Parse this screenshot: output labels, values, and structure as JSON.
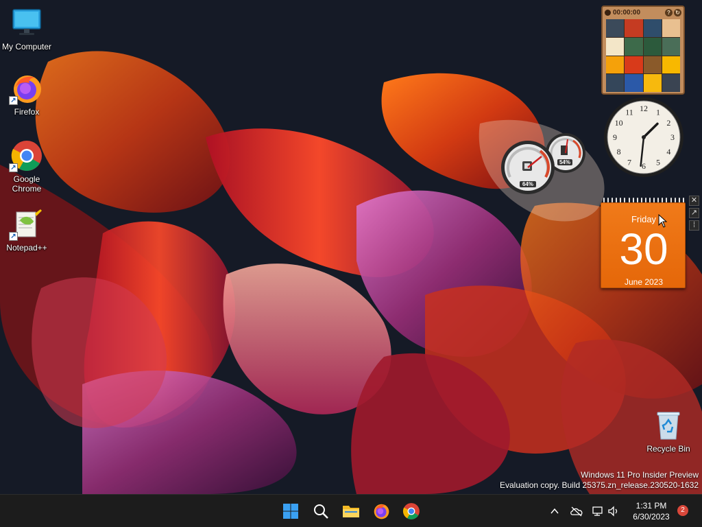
{
  "desktop": {
    "icons": [
      {
        "label": "My Computer",
        "icon": "monitor-icon"
      },
      {
        "label": "Firefox",
        "icon": "firefox-icon"
      },
      {
        "label": "Google\nChrome",
        "icon": "chrome-icon"
      },
      {
        "label": "Notepad++",
        "icon": "notepadpp-icon"
      },
      {
        "label": "Recycle Bin",
        "icon": "recycle-bin-icon"
      }
    ],
    "watermark": {
      "line1": "Windows 11 Pro Insider Preview",
      "line2": "Evaluation copy. Build 25375.zn_release.230520-1632"
    }
  },
  "gadgets": {
    "puzzle": {
      "timer": "00:00:00",
      "help": "?",
      "refresh": "↻"
    },
    "clock": {
      "hour": 1,
      "minute": 31
    },
    "cpu_meter": {
      "cpu_percent": "64%",
      "memory_percent": "54%"
    },
    "calendar": {
      "weekday": "Friday",
      "day": "30",
      "month_year": "June 2023"
    },
    "tools": {
      "close": "✕",
      "options": "↗",
      "drag": "⁞"
    }
  },
  "taskbar": {
    "apps": [
      "start-icon",
      "search-icon",
      "file-explorer-icon",
      "firefox-icon",
      "chrome-icon"
    ],
    "tray": [
      "chevron-up-icon",
      "onedrive-icon",
      "network-icon",
      "volume-icon"
    ],
    "time": "1:31 PM",
    "date": "6/30/2023",
    "notification_count": "2"
  }
}
